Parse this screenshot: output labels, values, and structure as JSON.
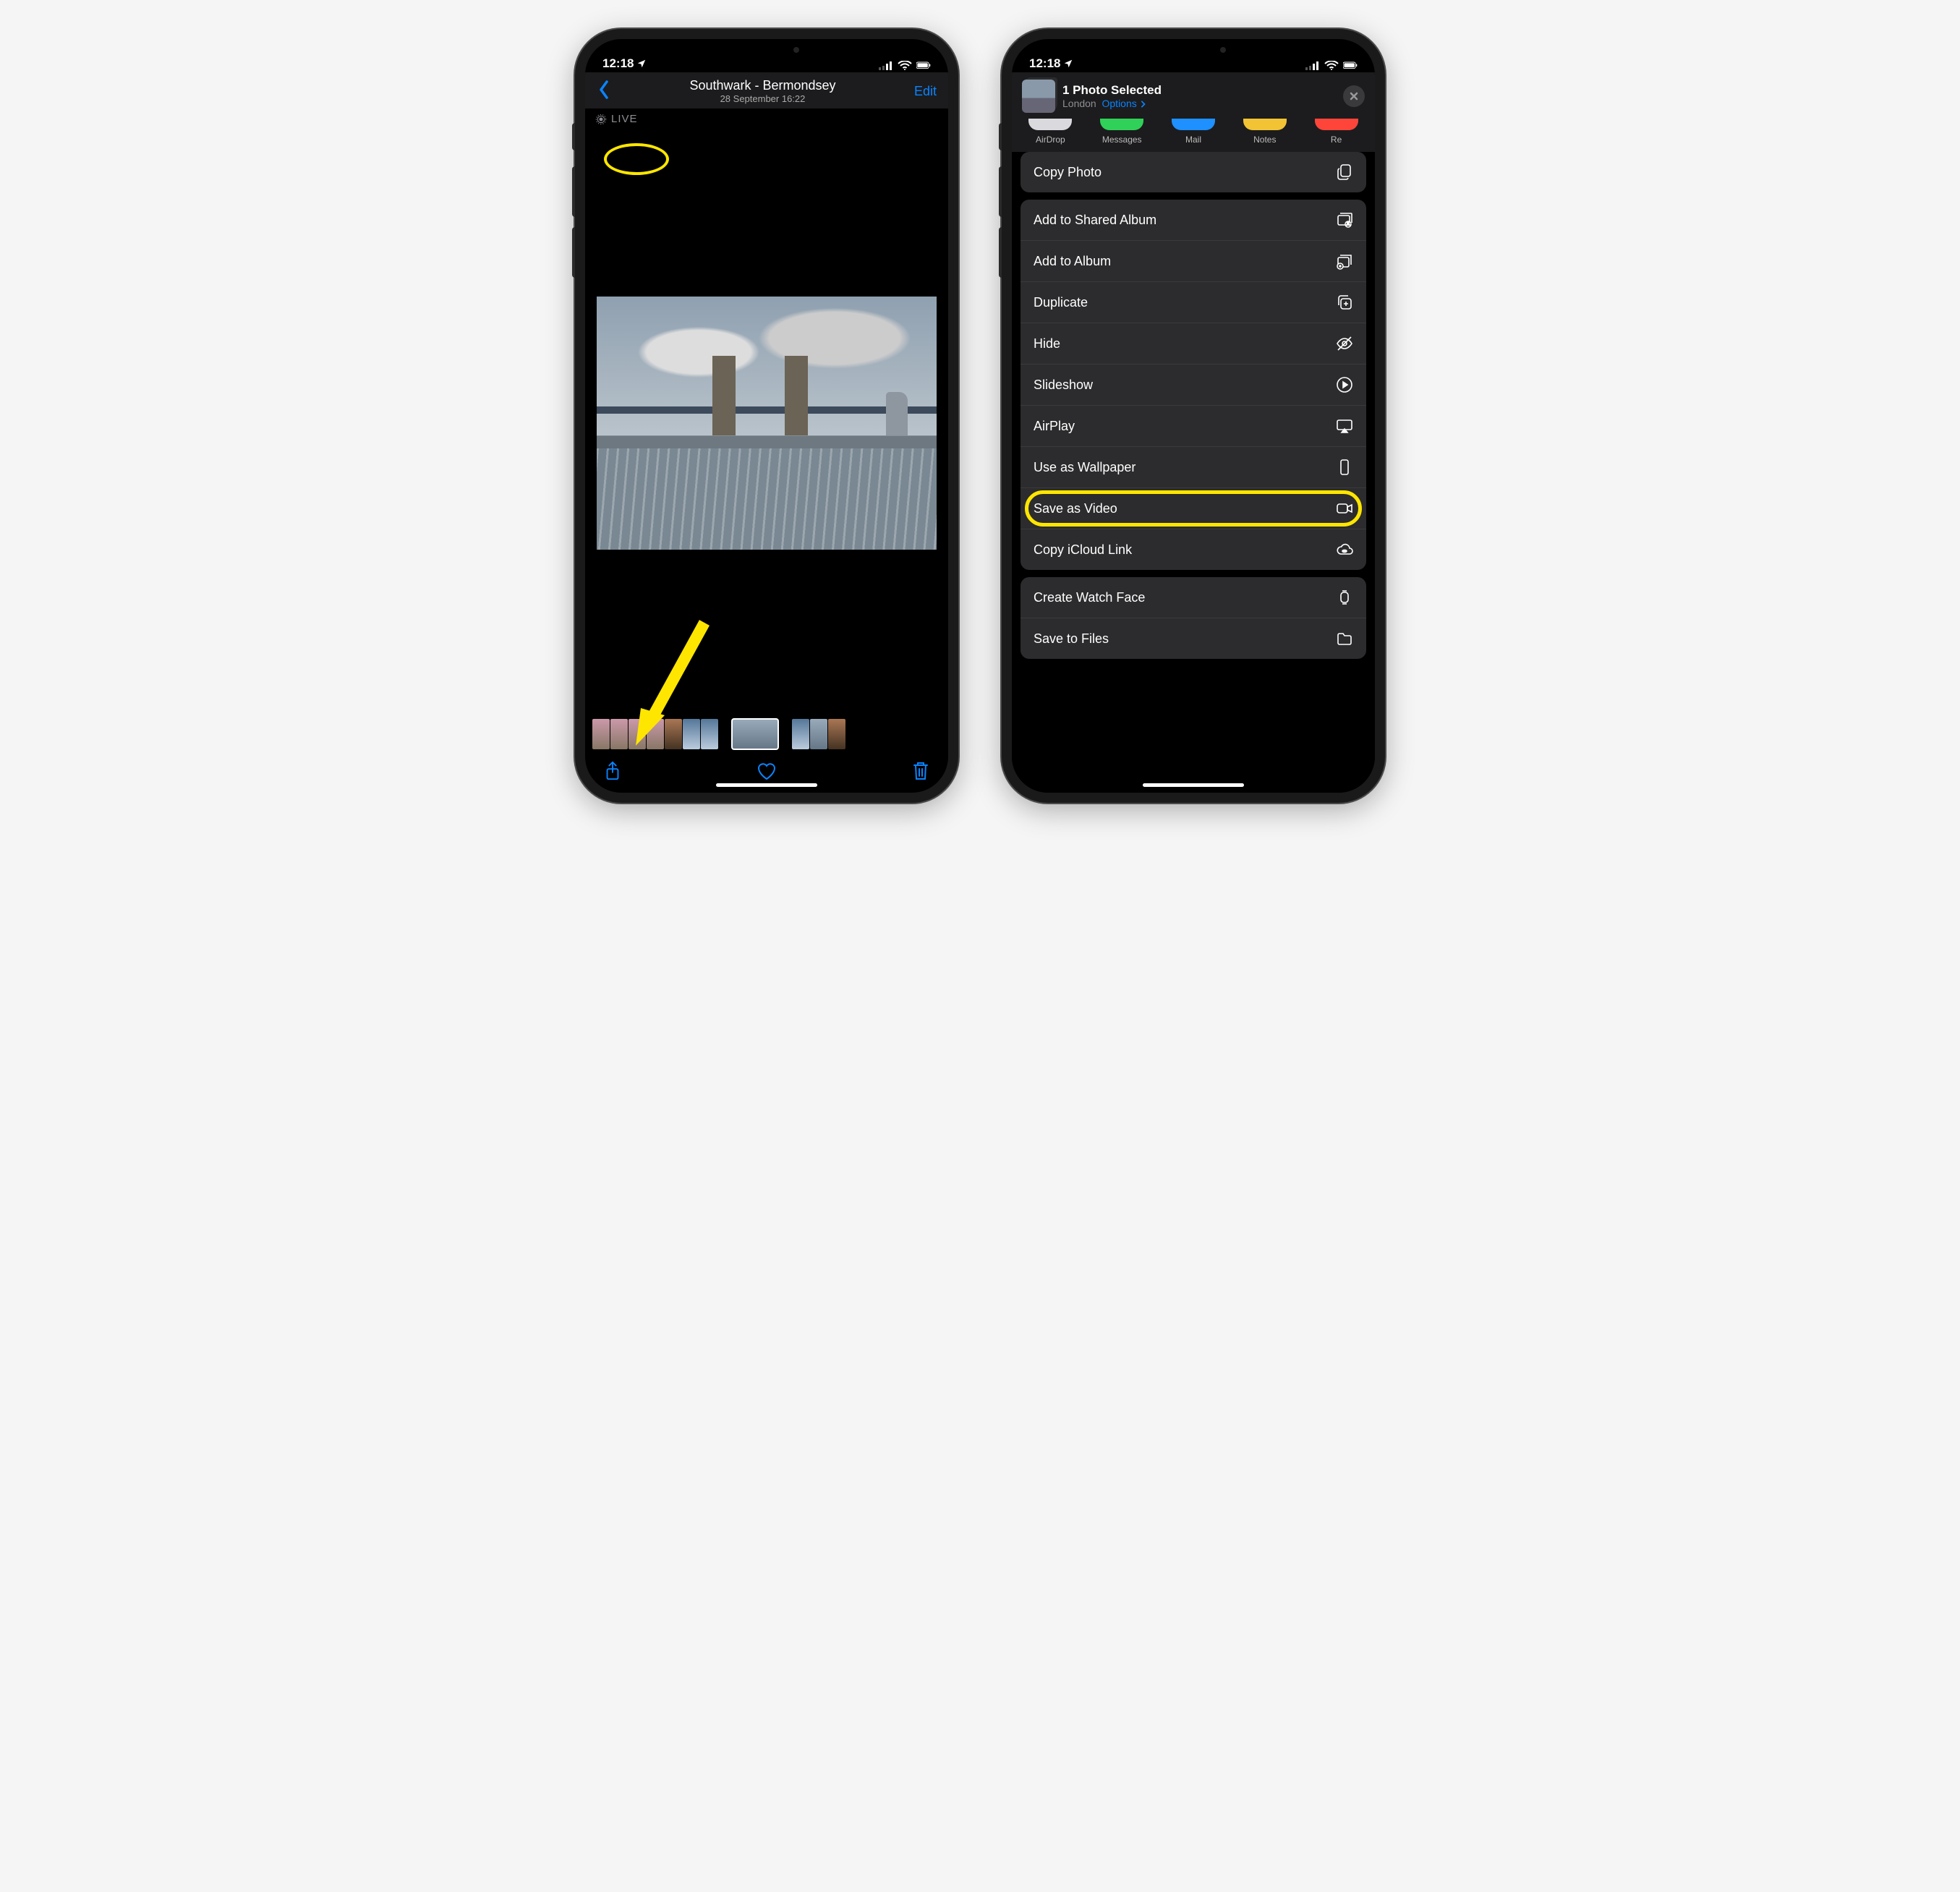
{
  "status": {
    "time": "12:18"
  },
  "left": {
    "title": "Southwark - Bermondsey",
    "subtitle": "28 September  16:22",
    "edit": "Edit",
    "live_badge": "LIVE"
  },
  "right": {
    "selected_title": "1 Photo Selected",
    "location": "London",
    "options_label": "Options",
    "quick": {
      "airdrop": "AirDrop",
      "messages": "Messages",
      "mail": "Mail",
      "notes": "Notes",
      "re": "Re"
    },
    "actions": {
      "copy_photo": "Copy Photo",
      "add_shared": "Add to Shared Album",
      "add_album": "Add to Album",
      "duplicate": "Duplicate",
      "hide": "Hide",
      "slideshow": "Slideshow",
      "airplay": "AirPlay",
      "wallpaper": "Use as Wallpaper",
      "save_video": "Save as Video",
      "icloud_link": "Copy iCloud Link",
      "watch_face": "Create Watch Face",
      "save_files": "Save to Files"
    }
  }
}
